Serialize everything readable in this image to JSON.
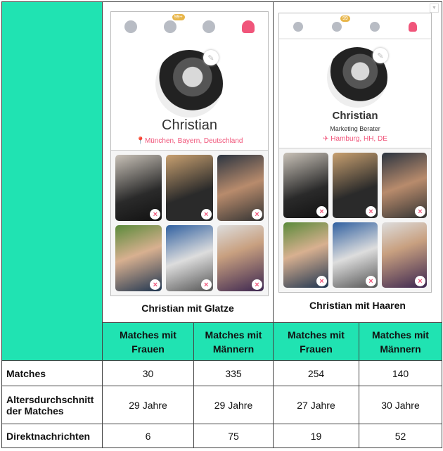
{
  "profiles": [
    {
      "name": "Christian",
      "subtitle": "",
      "location": "München, Bayern, Deutschland",
      "badge": "99+",
      "caption": "Christian mit Glatze"
    },
    {
      "name": "Christian",
      "subtitle": "Marketing Berater",
      "location": "Hamburg, HH, DE",
      "badge": "99",
      "caption": "Christian mit Haaren"
    }
  ],
  "table": {
    "headers": [
      "Matches mit Frauen",
      "Matches mit Männern",
      "Matches mit Frauen",
      "Matches mit Männern"
    ],
    "rows": [
      {
        "label": "Matches",
        "values": [
          "30",
          "335",
          "254",
          "140"
        ]
      },
      {
        "label": "Altersdurchschnitt der Matches",
        "values": [
          "29 Jahre",
          "29 Jahre",
          "27 Jahre",
          "30 Jahre"
        ]
      },
      {
        "label": "Direktnachrichten",
        "values": [
          "6",
          "75",
          "19",
          "52"
        ]
      }
    ]
  },
  "colors": {
    "accent": "#20e3b2",
    "brand": "#f0557a"
  },
  "icons": [
    "flame-icon",
    "sparkle-icon",
    "chat-icon",
    "profile-icon",
    "edit-icon",
    "location-pin-icon",
    "remove-photo-icon",
    "dropdown-icon"
  ]
}
